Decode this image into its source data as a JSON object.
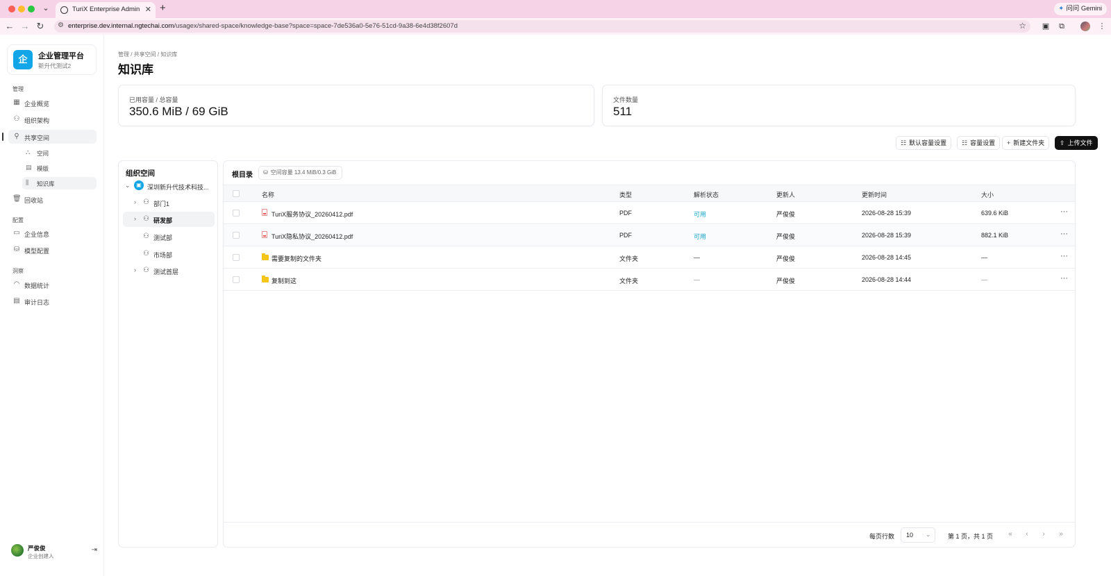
{
  "browser": {
    "tab_title": "TuriX Enterprise Admin",
    "url_host": "enterprise.dev.internal.ngtechai.com",
    "url_path": "/usagex/shared-space/knowledge-base?space=space-7de536a0-5e76-51cd-9a38-6e4d38f2607d",
    "gemini_label": "问问 Gemini"
  },
  "brand": {
    "logo_char": "企",
    "name": "企业管理平台",
    "subtitle": "新升代测试2"
  },
  "sidebar": {
    "sections": [
      {
        "label": "管理"
      },
      {
        "label": "配置"
      },
      {
        "label": "洞察"
      }
    ],
    "items": [
      {
        "label": "企业概览",
        "icon": "dashboard-icon"
      },
      {
        "label": "组织架构",
        "icon": "org-chart-icon"
      },
      {
        "label": "共享空间",
        "icon": "share-icon"
      },
      {
        "label": "空间",
        "icon": "space-icon"
      },
      {
        "label": "模版",
        "icon": "template-icon"
      },
      {
        "label": "知识库",
        "icon": "library-icon"
      },
      {
        "label": "回收站",
        "icon": "trash-icon"
      },
      {
        "label": "企业信息",
        "icon": "info-icon"
      },
      {
        "label": "模型配置",
        "icon": "database-icon"
      },
      {
        "label": "数据统计",
        "icon": "gauge-icon"
      },
      {
        "label": "审计日志",
        "icon": "log-icon"
      }
    ]
  },
  "user": {
    "name": "严俊俊",
    "role": "企业创建人"
  },
  "page": {
    "breadcrumb": "管理 / 共享空间 / 知识库",
    "title": "知识库"
  },
  "stats": {
    "capacity_label": "已用容量 / 总容量",
    "capacity_value": "350.6 MiB / 69 GiB",
    "files_label": "文件数量",
    "files_value": "511"
  },
  "actions": {
    "default_capacity": "默认容量设置",
    "capacity": "容量设置",
    "new_folder": "新建文件夹",
    "upload": "上传文件"
  },
  "tree": {
    "title": "组织空间",
    "nodes": [
      {
        "label": "深圳新升代技术科技..."
      },
      {
        "label": "部门1"
      },
      {
        "label": "研发部"
      },
      {
        "label": "测试部"
      },
      {
        "label": "市场部"
      },
      {
        "label": "测试首层"
      }
    ]
  },
  "files": {
    "root_label": "根目录",
    "quota_label": "空间容量 13.4 MiB/0.3 GiB",
    "columns": {
      "name": "名称",
      "type": "类型",
      "status": "解析状态",
      "updater": "更新人",
      "updated_at": "更新时间",
      "size": "大小"
    },
    "rows": [
      {
        "name": "TuriX服务协议_20260412.pdf",
        "type": "PDF",
        "status": "可用",
        "updater": "严俊俊",
        "updated_at": "2026-08-28 15:39",
        "size": "639.6 KiB",
        "kind": "pdf"
      },
      {
        "name": "TuriX隐私协议_20260412.pdf",
        "type": "PDF",
        "status": "可用",
        "updater": "严俊俊",
        "updated_at": "2026-08-28 15:39",
        "size": "882.1 KiB",
        "kind": "pdf"
      },
      {
        "name": "需要复制的文件夹",
        "type": "文件夹",
        "status": "—",
        "updater": "严俊俊",
        "updated_at": "2026-08-28 14:45",
        "size": "—",
        "kind": "folder"
      },
      {
        "name": "复制到这",
        "type": "文件夹",
        "status": "—",
        "updater": "严俊俊",
        "updated_at": "2026-08-28 14:44",
        "size": "—",
        "kind": "folder"
      }
    ]
  },
  "pagination": {
    "rows_per_page_label": "每页行数",
    "rows_per_page": "10",
    "page_info": "第 1 页，共 1 页"
  }
}
